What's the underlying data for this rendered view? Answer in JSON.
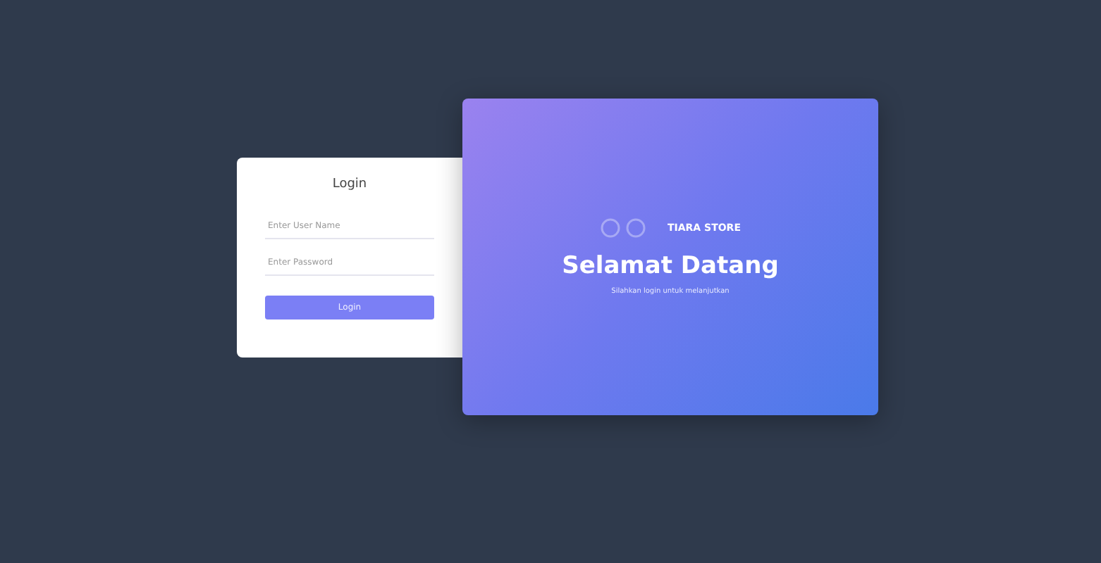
{
  "login": {
    "title": "Login",
    "fields": [
      {
        "placeholder": "Enter User Name"
      },
      {
        "placeholder": "Enter Password"
      }
    ],
    "button": "Login"
  },
  "welcome": {
    "brand": "TIARA STORE",
    "title": "Selamat Datang",
    "subtitle": "Silahkan login untuk melanjutkan"
  }
}
